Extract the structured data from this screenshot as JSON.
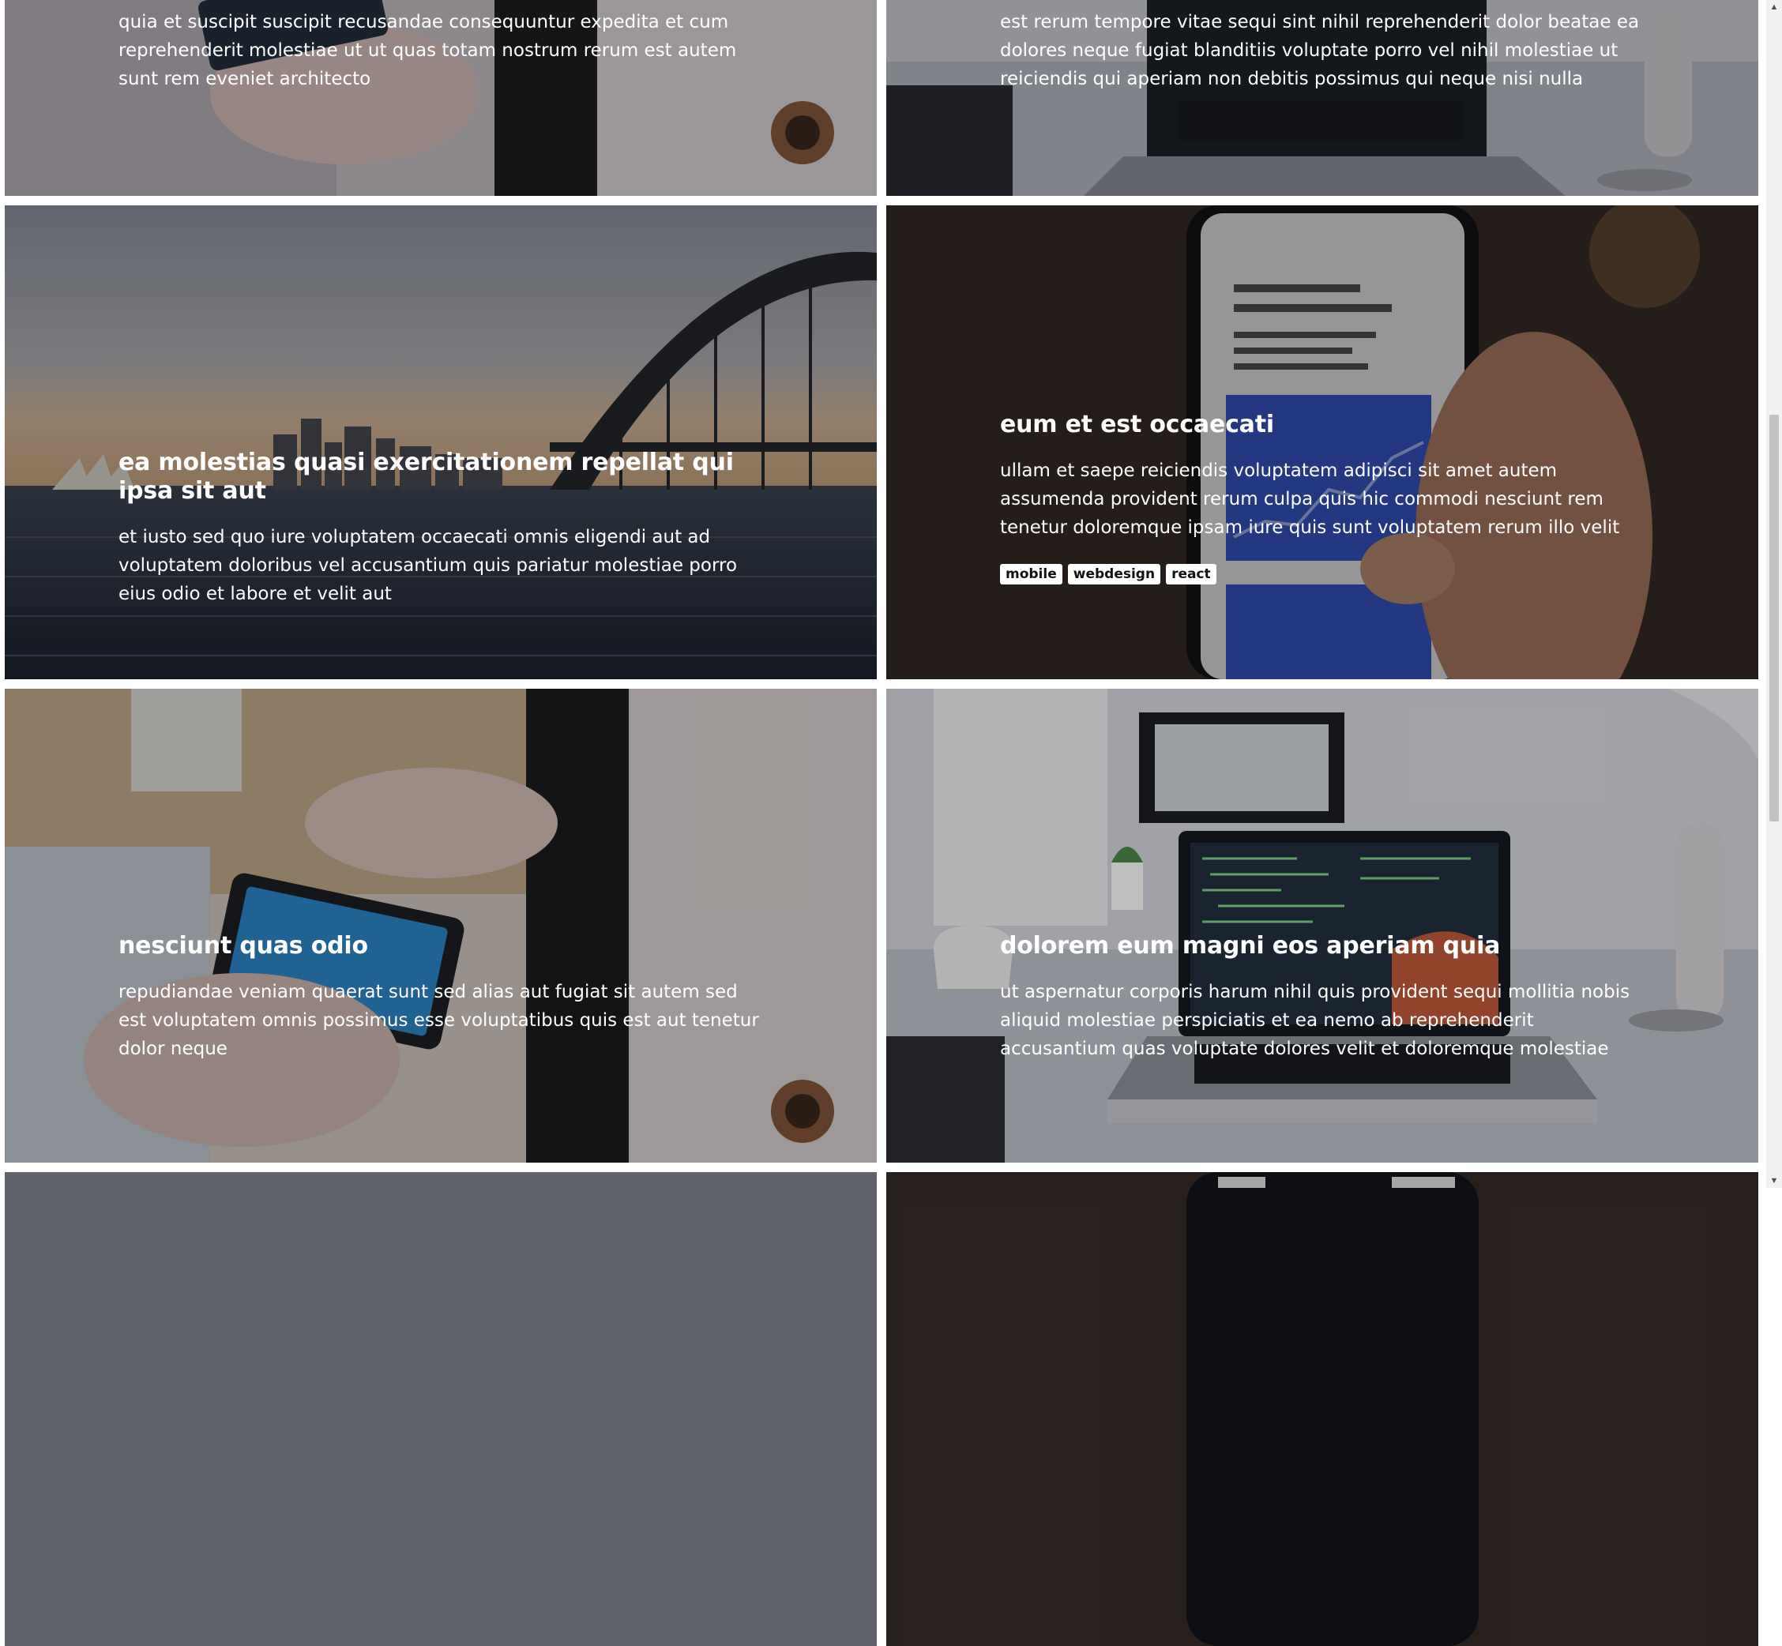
{
  "cards": [
    {
      "title": "",
      "text": "quia et suscipit suscipit recusandae consequuntur expedita et cum reprehenderit molestiae ut ut quas totam nostrum rerum est autem sunt rem eveniet architecto",
      "tags": []
    },
    {
      "title": "",
      "text": "est rerum tempore vitae sequi sint nihil reprehenderit dolor beatae ea dolores neque fugiat blanditiis voluptate porro vel nihil molestiae ut reiciendis qui aperiam non debitis possimus qui neque nisi nulla",
      "tags": []
    },
    {
      "title": "ea molestias quasi exercitationem repellat qui ipsa sit aut",
      "text": "et iusto sed quo iure voluptatem occaecati omnis eligendi aut ad voluptatem doloribus vel accusantium quis pariatur molestiae porro eius odio et labore et velit aut",
      "tags": []
    },
    {
      "title": "eum et est occaecati",
      "text": "ullam et saepe reiciendis voluptatem adipisci sit amet autem assumenda provident rerum culpa quis hic commodi nesciunt rem tenetur doloremque ipsam iure quis sunt voluptatem rerum illo velit",
      "tags": [
        "mobile",
        "webdesign",
        "react"
      ]
    },
    {
      "title": "nesciunt quas odio",
      "text": "repudiandae veniam quaerat sunt sed alias aut fugiat sit autem sed est voluptatem omnis possimus esse voluptatibus quis est aut tenetur dolor neque",
      "tags": []
    },
    {
      "title": "dolorem eum magni eos aperiam quia",
      "text": "ut aspernatur corporis harum nihil quis provident sequi mollitia nobis aliquid molestiae perspiciatis et ea nemo ab reprehenderit accusantium quas voluptate dolores velit et doloremque molestiae",
      "tags": []
    }
  ]
}
